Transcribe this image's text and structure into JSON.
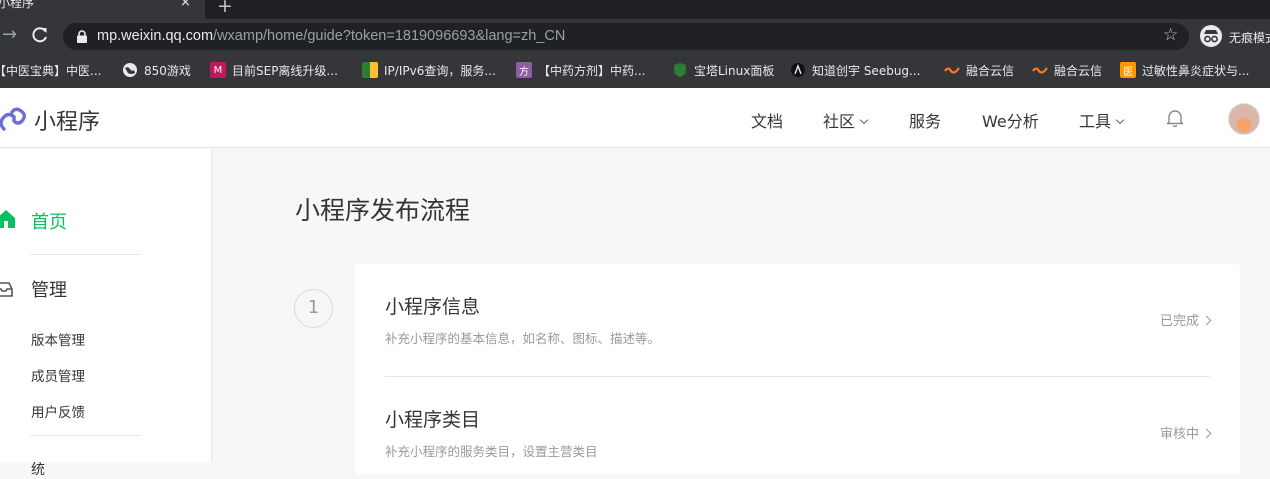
{
  "browser": {
    "tab_title": "小程序",
    "tab_close": "×",
    "new_tab": "+",
    "url_host": "mp.weixin.qq.com",
    "url_path": "/wxamp/home/guide?token=1819096693&lang=zh_CN",
    "incognito_label": "无痕模式",
    "bookmarks": [
      {
        "label": "【中医宝典】中医...",
        "icon": "book-icon",
        "color": "#35363a"
      },
      {
        "label": "850游戏",
        "icon": "globe-icon",
        "color": "#35363a"
      },
      {
        "label": "目前SEP离线升级...",
        "icon": "site-icon",
        "color": "#c2185b"
      },
      {
        "label": "IP/IPv6查询，服务...",
        "icon": "site-icon",
        "color": "#2e7d32"
      },
      {
        "label": "【中药方剂】中药...",
        "icon": "fang-icon",
        "color": "#8e5ea2",
        "glyph": "方"
      },
      {
        "label": "宝塔Linux面板",
        "icon": "shield-icon",
        "color": "#2e7d32"
      },
      {
        "label": "知道创宇 Seebug...",
        "icon": "bug-icon",
        "color": "#111111"
      },
      {
        "label": "融合云信",
        "icon": "wave-icon",
        "color": "#ff7a1a"
      },
      {
        "label": "融合云信",
        "icon": "wave-icon",
        "color": "#ff7a1a"
      },
      {
        "label": "过敏性鼻炎症状与...",
        "icon": "yi-icon",
        "color": "#ff9800",
        "glyph": "医"
      }
    ]
  },
  "header": {
    "logo_text": "小程序",
    "nav": {
      "docs": "文档",
      "community": "社区",
      "service": "服务",
      "we_analytics": "We分析",
      "tools": "工具"
    }
  },
  "sidebar": {
    "home": "首页",
    "manage": "管理",
    "sub_items": [
      "版本管理",
      "成员管理",
      "用户反馈"
    ],
    "partial": "统"
  },
  "main": {
    "title": "小程序发布流程",
    "step_number": "1",
    "steps": [
      {
        "title": "小程序信息",
        "desc": "补充小程序的基本信息，如名称、图标、描述等。",
        "status": "已完成"
      },
      {
        "title": "小程序类目",
        "desc": "补充小程序的服务类目，设置主营类目",
        "status": "审核中"
      }
    ]
  },
  "colors": {
    "accent": "#07c160",
    "chrome_dark": "#202124",
    "chrome": "#35363a"
  }
}
